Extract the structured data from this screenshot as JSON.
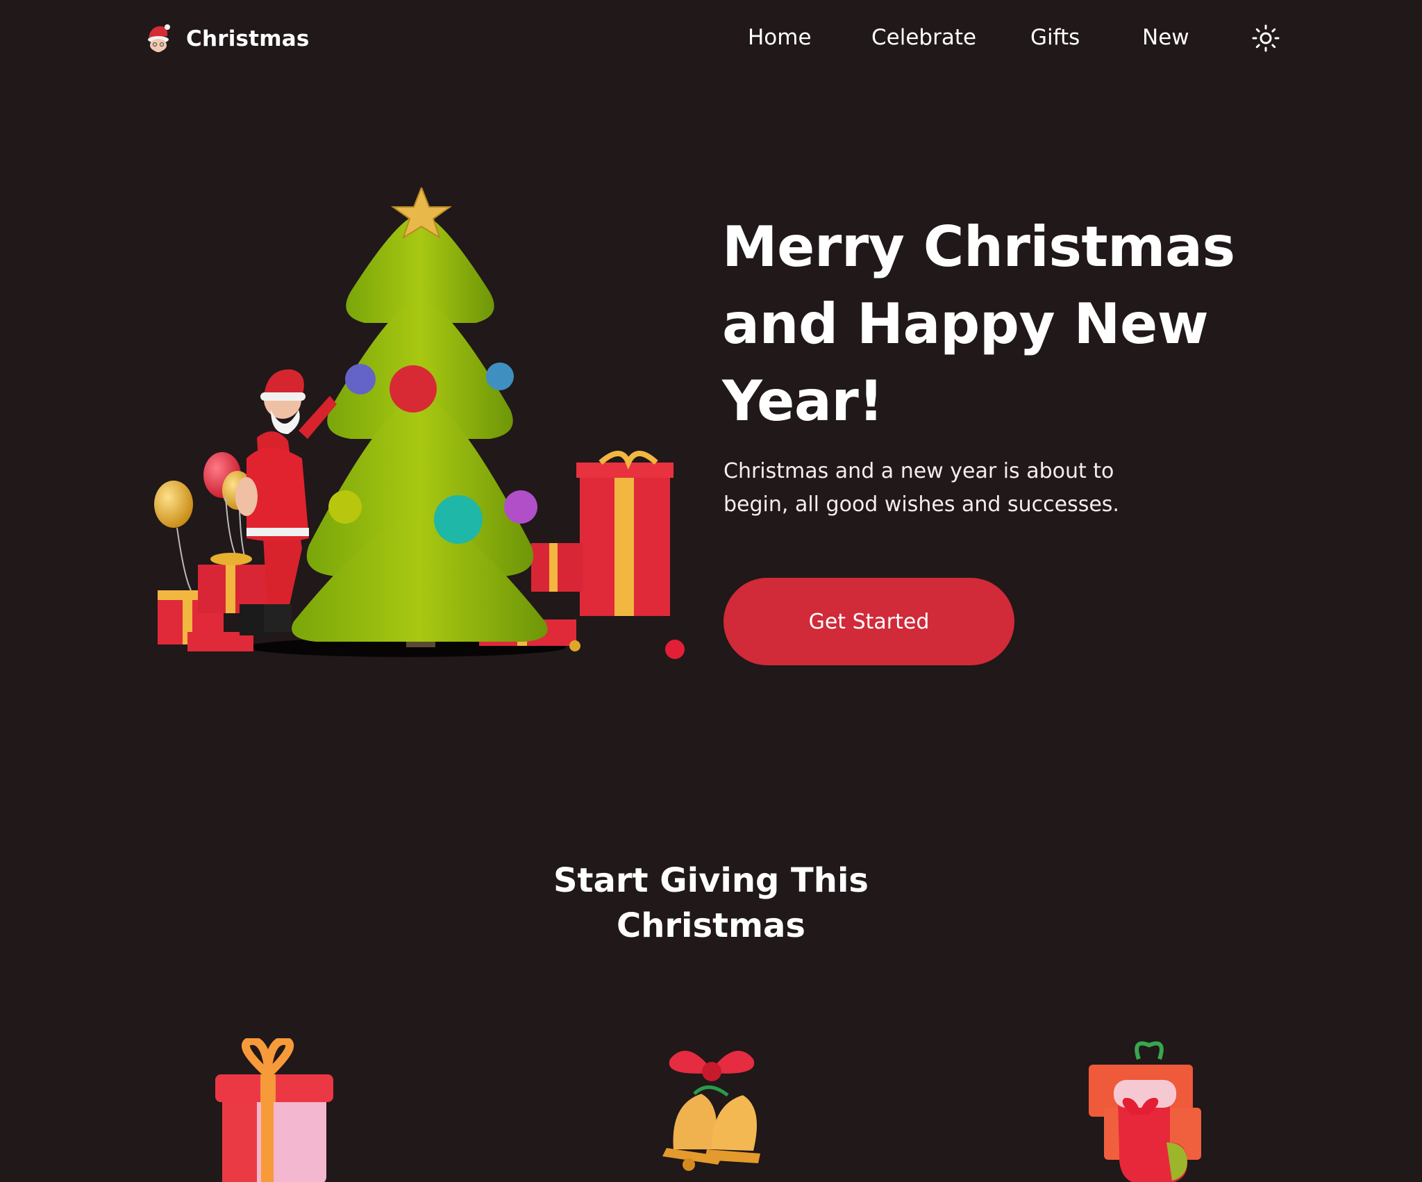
{
  "brand": {
    "name": "Christmas",
    "logo_icon": "santa-face-icon"
  },
  "nav": {
    "items": [
      {
        "label": "Home"
      },
      {
        "label": "Celebrate"
      },
      {
        "label": "Gifts"
      },
      {
        "label": "New"
      }
    ],
    "theme_toggle_icon": "sun-icon"
  },
  "hero": {
    "title": "Merry Christmas and Happy New Year!",
    "description": "Christmas and a new year is about to begin, all good wishes and successes.",
    "cta_label": "Get Started",
    "illustration_icon": "santa-decorating-christmas-tree-illustration"
  },
  "section": {
    "title": "Start Giving This Christmas",
    "items": [
      {
        "icon": "gift-box-icon"
      },
      {
        "icon": "christmas-bells-icon"
      },
      {
        "icon": "christmas-stocking-icon"
      }
    ]
  },
  "colors": {
    "background": "#201819",
    "accent": "#d12a39",
    "text": "#ffffff"
  }
}
